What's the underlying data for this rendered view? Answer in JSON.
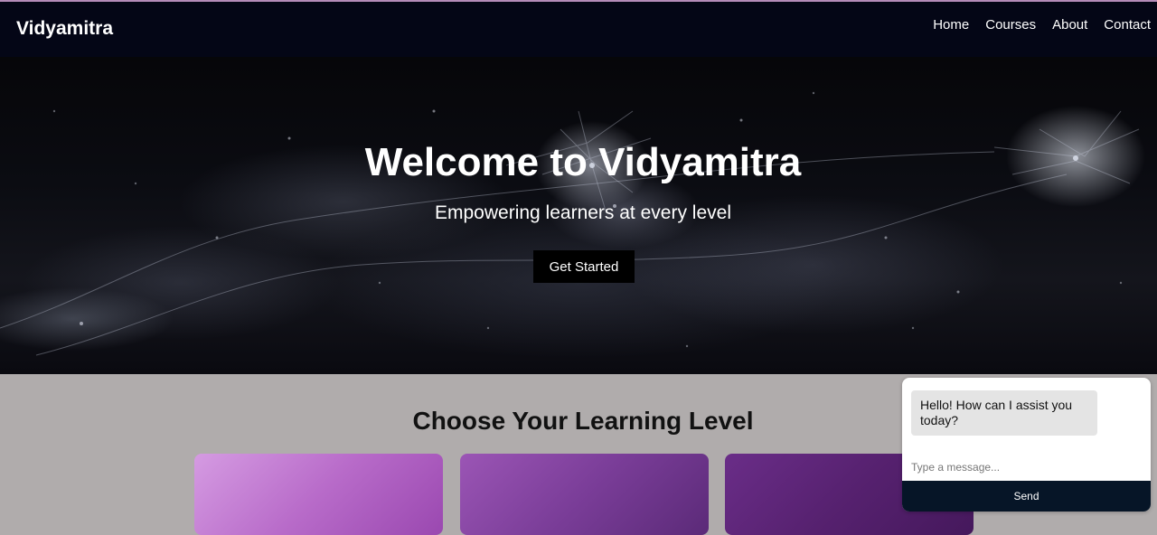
{
  "navbar": {
    "brand": "Vidyamitra",
    "links": [
      "Home",
      "Courses",
      "About",
      "Contact"
    ]
  },
  "hero": {
    "title": "Welcome to Vidyamitra",
    "subtitle": "Empowering learners at every level",
    "cta_label": "Get Started"
  },
  "levels": {
    "title": "Choose Your Learning Level"
  },
  "chat": {
    "greeting": "Hello! How can I assist you today?",
    "input_placeholder": "Type a message...",
    "send_label": "Send"
  },
  "colors": {
    "navbar_bg": "#040616",
    "section_bg": "#b0acac",
    "send_bg": "#061527",
    "card_1": "#c27ad3",
    "card_2": "#7a3d98",
    "card_3": "#56216f"
  }
}
